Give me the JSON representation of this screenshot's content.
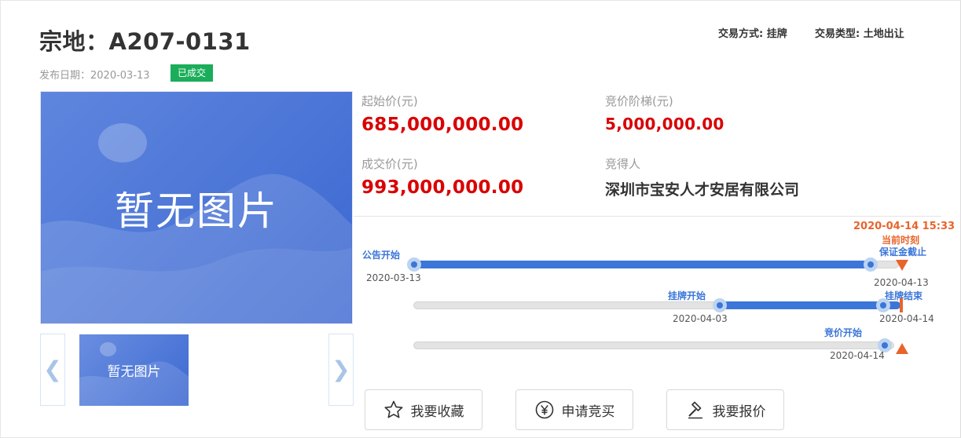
{
  "header": {
    "title": "宗地：A207-0131",
    "publish_date_label": "发布日期：2020-03-13",
    "status_badge": "已成交",
    "trade_method": "交易方式: 挂牌",
    "trade_type": "交易类型: 土地出让"
  },
  "gallery": {
    "main_placeholder": "暂无图片",
    "thumb_placeholder": "暂无图片",
    "prev_glyph": "❮",
    "next_glyph": "❯"
  },
  "pricing": {
    "start_price_label": "起始价(元)",
    "start_price": "685,000,000.00",
    "increment_label": "竞价阶梯(元)",
    "increment": "5,000,000.00",
    "deal_price_label": "成交价(元)",
    "deal_price": "993,000,000.00",
    "winner_label": "竞得人",
    "winner": "深圳市宝安人才安居有限公司"
  },
  "timeline": {
    "current_time": "2020-04-14 15:33",
    "current_label": "当前时刻",
    "row1": {
      "start_label": "公告开始",
      "start_date": "2020-03-13",
      "end_label": "保证金截止",
      "end_date": "2020-04-13"
    },
    "row2": {
      "start_label": "挂牌开始",
      "start_date": "2020-04-03",
      "end_label": "挂牌结束",
      "end_date": "2020-04-14"
    },
    "row3": {
      "start_label": "竞价开始",
      "start_date": "2020-04-14"
    }
  },
  "actions": {
    "favorite": "我要收藏",
    "apply": "申请竞买",
    "bid": "我要报价"
  },
  "colors": {
    "accent": "#3b76d8",
    "price": "#d90000",
    "success": "#1aad5a",
    "now": "#e8642a"
  }
}
